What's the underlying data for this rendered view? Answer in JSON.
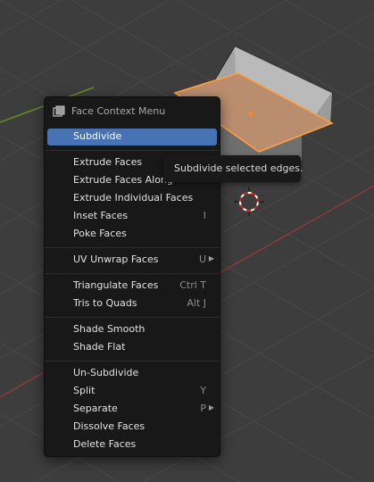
{
  "viewport": {
    "background_color": "#3d3d3d",
    "x_axis_color": "#8b3a3a",
    "y_axis_color": "#6a8e22",
    "cube_top_color": "#bb8d6f",
    "cube_side_color": "#9a9a9a",
    "selection_outline_color": "#ffa13d",
    "origin_dot_color": "#ff8c1a"
  },
  "menu": {
    "title": "Face Context Menu",
    "header_icon": "face-select-icon",
    "accent_color": "#4772b3",
    "groups": [
      [
        {
          "name": "subdivide",
          "label": "Subdivide",
          "shortcut": "",
          "submenu": false,
          "active": true
        }
      ],
      [
        {
          "name": "extrude-faces",
          "label": "Extrude Faces",
          "shortcut": "",
          "submenu": false
        },
        {
          "name": "extrude-faces-along-normals",
          "label": "Extrude Faces Along",
          "shortcut": "",
          "submenu": false
        },
        {
          "name": "extrude-individual-faces",
          "label": "Extrude Individual Faces",
          "shortcut": "",
          "submenu": false
        },
        {
          "name": "inset-faces",
          "label": "Inset Faces",
          "shortcut": "I",
          "submenu": false
        },
        {
          "name": "poke-faces",
          "label": "Poke Faces",
          "shortcut": "",
          "submenu": false
        }
      ],
      [
        {
          "name": "uv-unwrap-faces",
          "label": "UV Unwrap Faces",
          "shortcut": "U",
          "submenu": true
        }
      ],
      [
        {
          "name": "triangulate-faces",
          "label": "Triangulate Faces",
          "shortcut": "Ctrl T",
          "submenu": false
        },
        {
          "name": "tris-to-quads",
          "label": "Tris to Quads",
          "shortcut": "Alt J",
          "submenu": false
        }
      ],
      [
        {
          "name": "shade-smooth",
          "label": "Shade Smooth",
          "shortcut": "",
          "submenu": false
        },
        {
          "name": "shade-flat",
          "label": "Shade Flat",
          "shortcut": "",
          "submenu": false
        }
      ],
      [
        {
          "name": "un-subdivide",
          "label": "Un-Subdivide",
          "shortcut": "",
          "submenu": false
        },
        {
          "name": "split",
          "label": "Split",
          "shortcut": "Y",
          "submenu": false
        },
        {
          "name": "separate",
          "label": "Separate",
          "shortcut": "P",
          "submenu": true
        },
        {
          "name": "dissolve-faces",
          "label": "Dissolve Faces",
          "shortcut": "",
          "submenu": false
        },
        {
          "name": "delete-faces",
          "label": "Delete Faces",
          "shortcut": "",
          "submenu": false
        }
      ]
    ]
  },
  "tooltip": {
    "text": "Subdivide selected edges."
  }
}
